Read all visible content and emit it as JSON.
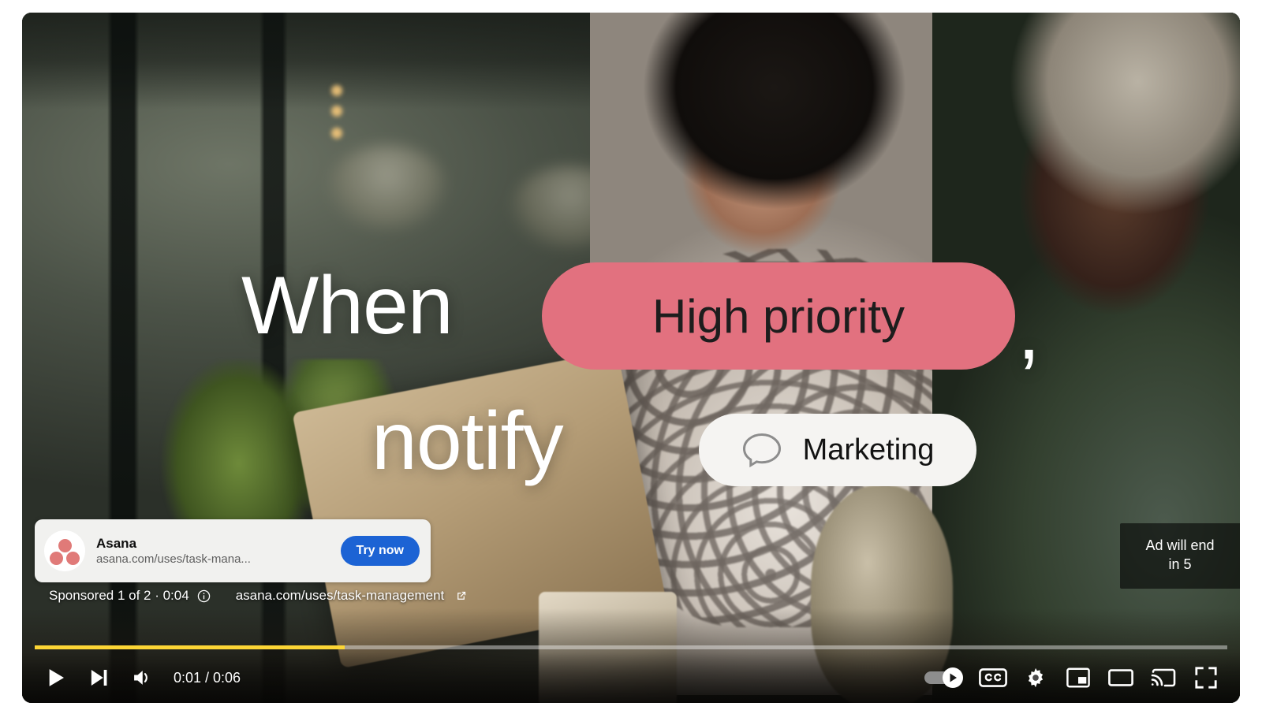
{
  "player": {
    "state": "playing-ad",
    "progress_percent": 26,
    "accent_color": "#fcd535",
    "time_display": "0:01 / 0:06",
    "current_time": "0:01",
    "duration": "0:06"
  },
  "ad_creative": {
    "headline_word_1": "When",
    "headline_word_2": "notify",
    "headline_punctuation": ",",
    "priority_pill_label": "High priority",
    "priority_pill_color": "#e2717f",
    "marketing_pill_label": "Marketing",
    "marketing_pill_color": "#f5f4f2",
    "bubble_icon": "speech-bubble-icon"
  },
  "ad_card": {
    "advertiser_name": "Asana",
    "display_url": "asana.com/uses/task-mana...",
    "cta_label": "Try now",
    "cta_color": "#1c63d4",
    "logo_icon": "asana-logo-icon",
    "logo_color": "#e07a78"
  },
  "sponsored_row": {
    "sponsored_text": "Sponsored 1 of 2 · 0:04",
    "info_icon": "info-circle-icon",
    "link_url": "asana.com/uses/task-management",
    "external_icon": "external-link-icon"
  },
  "ad_countdown": {
    "line_1": "Ad will end",
    "line_2": "in 5"
  },
  "controls": {
    "play": {
      "label": "Play",
      "icon": "play-icon"
    },
    "next": {
      "label": "Next",
      "icon": "next-track-icon"
    },
    "volume": {
      "label": "Mute",
      "icon": "volume-high-icon"
    },
    "autoplay": {
      "label": "Autoplay is on",
      "icon": "autoplay-toggle-icon",
      "state": "on"
    },
    "subtitles": {
      "label": "Subtitles/closed captions",
      "icon": "closed-captions-icon"
    },
    "settings": {
      "label": "Settings",
      "icon": "gear-icon"
    },
    "miniplayer": {
      "label": "Miniplayer",
      "icon": "miniplayer-icon"
    },
    "theater": {
      "label": "Theater mode",
      "icon": "theater-mode-icon"
    },
    "cast": {
      "label": "Play on TV",
      "icon": "cast-icon"
    },
    "fullscreen": {
      "label": "Full screen",
      "icon": "fullscreen-icon"
    }
  }
}
